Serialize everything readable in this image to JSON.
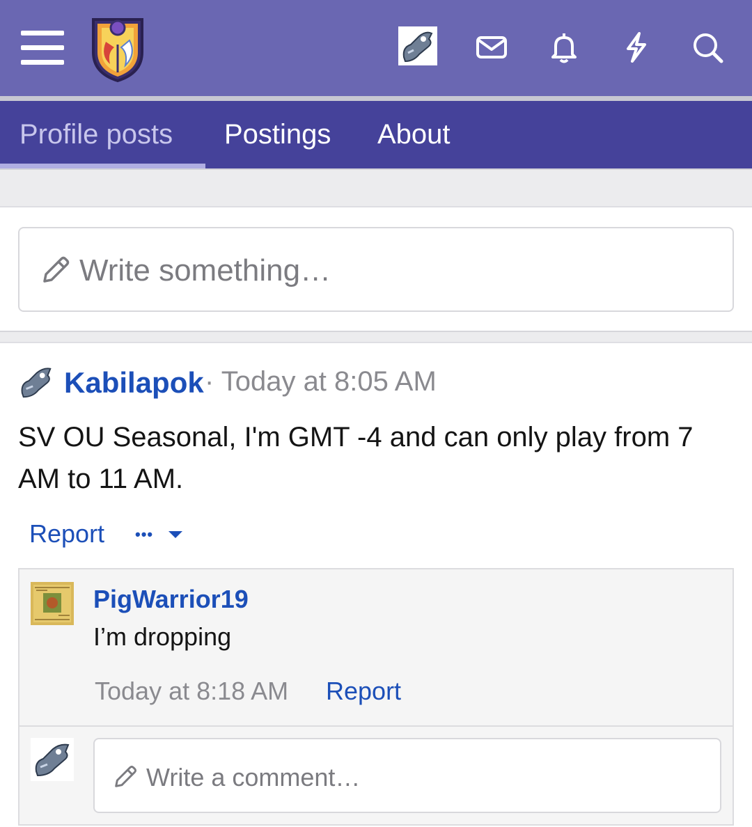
{
  "header": {
    "icons": [
      "menu-icon",
      "site-logo",
      "user-avatar",
      "inbox-icon",
      "bell-icon",
      "lightning-icon",
      "search-icon"
    ],
    "bar_color": "#6a67b2"
  },
  "tabs": [
    {
      "label": "Profile posts",
      "active": true
    },
    {
      "label": "Postings",
      "active": false
    },
    {
      "label": "About",
      "active": false
    }
  ],
  "composer": {
    "placeholder": "Write something…"
  },
  "post": {
    "author": "Kabilapok",
    "time": "· Today at 8:05 AM",
    "body": "SV OU Seasonal, I'm GMT -4 and can only play from 7 AM to 11 AM.",
    "report_label": "Report",
    "more_label": "•••"
  },
  "comment": {
    "author": "PigWarrior19",
    "body": "I’m dropping",
    "time": "Today at 8:18 AM",
    "report_label": "Report"
  },
  "comment_input": {
    "placeholder": "Write a comment…"
  },
  "colors": {
    "link": "#1c4fb8",
    "tabbar": "#45429a"
  }
}
